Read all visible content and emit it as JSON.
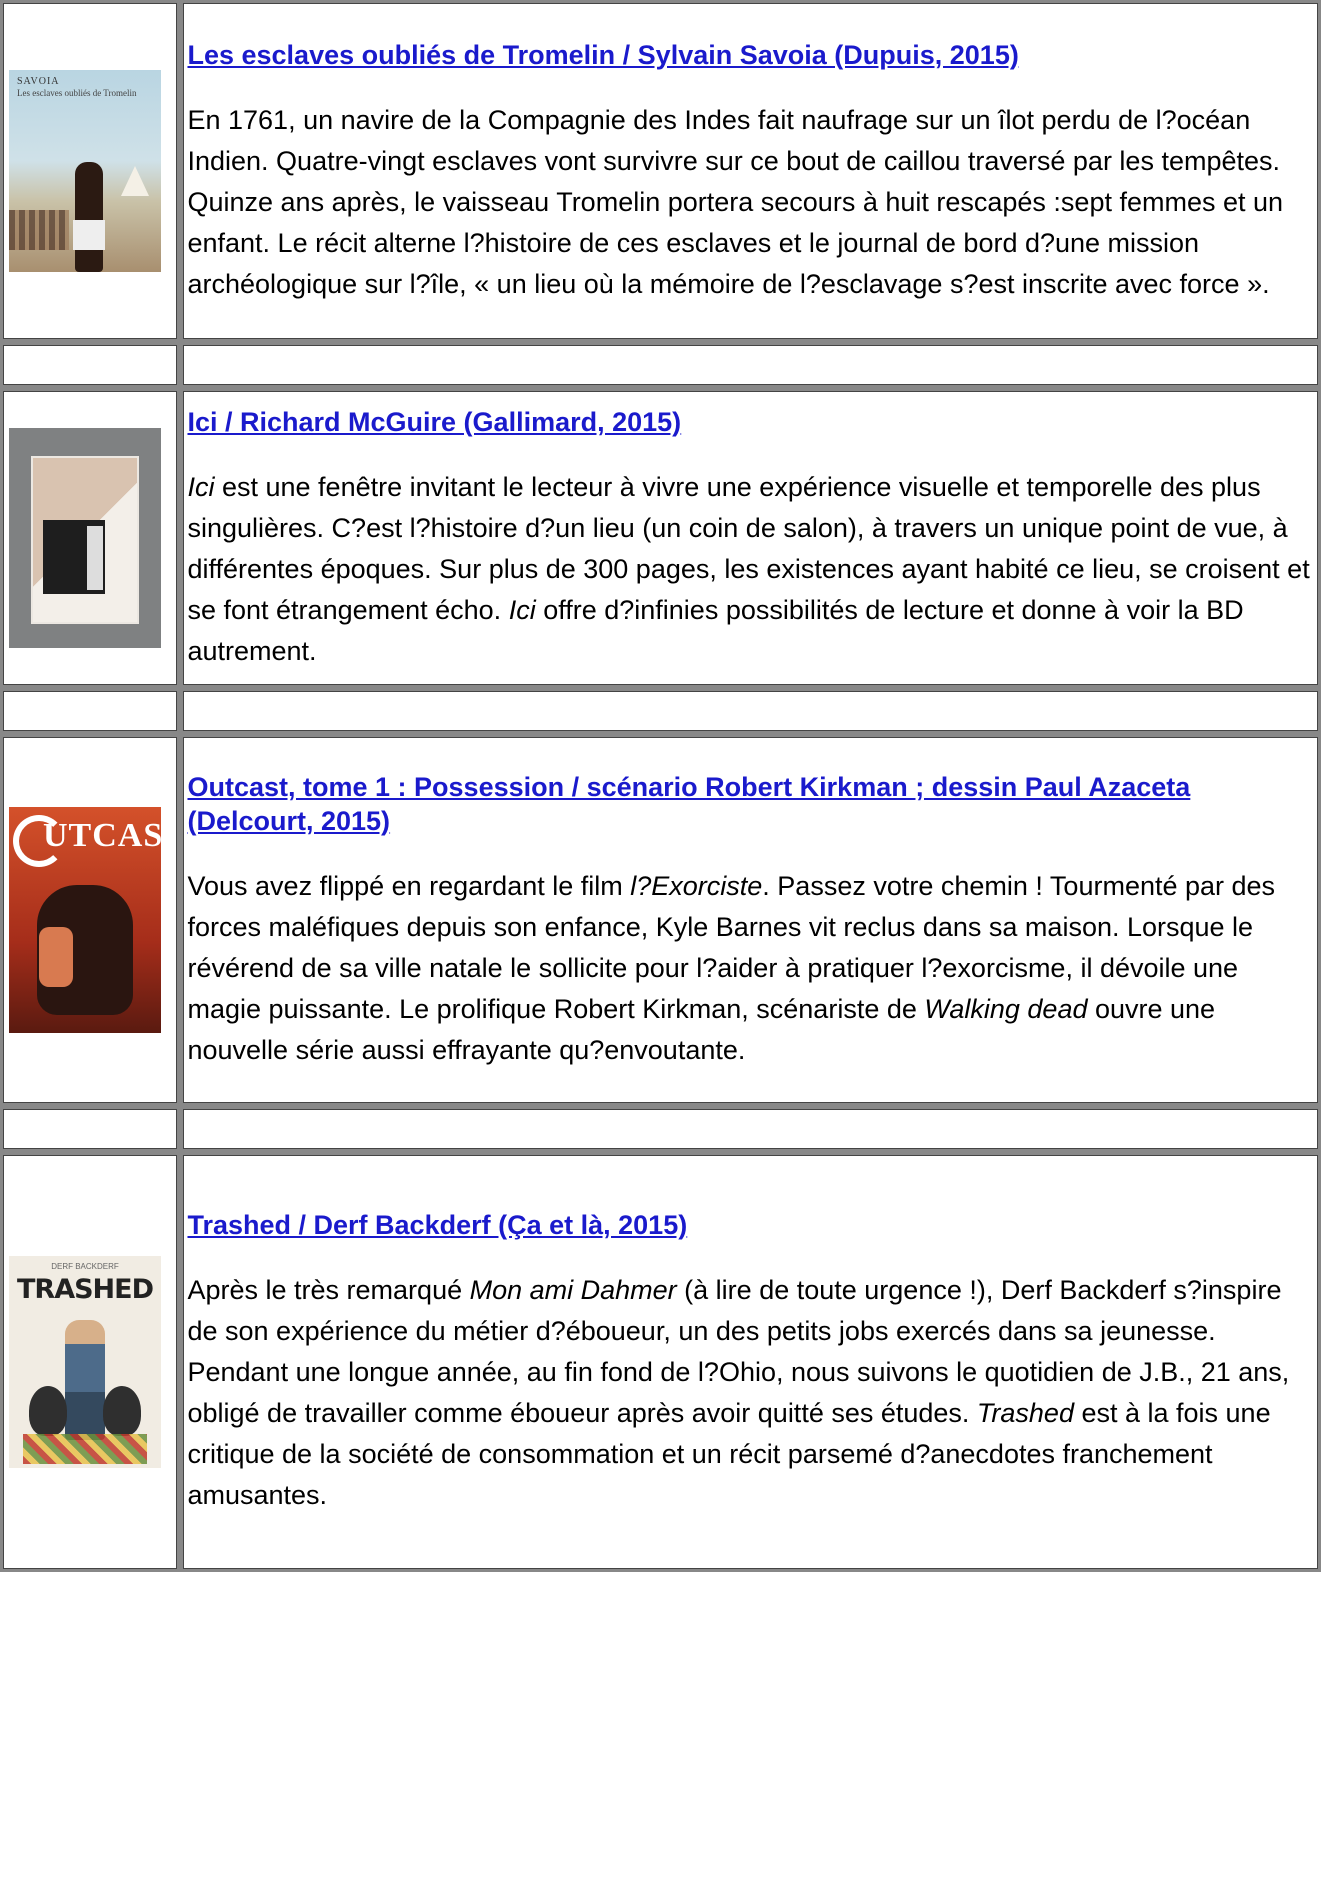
{
  "books": [
    {
      "cover_icon": "tromelin-cover",
      "cover_text": {
        "author": "SAVOIA",
        "title": "Les esclaves oubliés de Tromelin"
      },
      "title": "Les esclaves oubliés de Tromelin / Sylvain Savoia (Dupuis, 2015)",
      "description": "En 1761, un navire de la Compagnie des Indes fait naufrage sur un îlot perdu de l?océan Indien. Quatre-vingt esclaves vont survivre sur ce bout de caillou traversé par les tempêtes. Quinze ans après, le vaisseau Tromelin portera secours à huit rescapés :sept femmes et un enfant. Le récit alterne l?histoire de ces esclaves et le journal de bord d?une mission archéologique sur l?île, « un lieu où la mémoire de l?esclavage s?est inscrite avec force »."
    },
    {
      "cover_icon": "ici-cover",
      "title": "Ici / Richard McGuire (Gallimard, 2015)",
      "description_italic_lead": "Ici",
      "description_part1": " est une fenêtre invitant le lecteur à vivre une expérience visuelle et temporelle des plus singulières. C?est l?histoire d?un lieu (un coin de salon), à travers un unique point de vue, à différentes époques. Sur plus de 300 pages, les existences ayant habité ce lieu, se croisent et se font étrangement écho. ",
      "description_italic_2": "Ici",
      "description_part2": " offre d?infinies possibilités de lecture et donne à voir la BD autrement."
    },
    {
      "cover_icon": "outcast-cover",
      "cover_text": {
        "logo": "UTCAST"
      },
      "title": "Outcast, tome 1 : Possession / scénario Robert Kirkman ; dessin Paul Azaceta (Delcourt, 2015)",
      "description_part1": "Vous avez flippé en regardant le film ",
      "description_italic_1": "l?Exorciste",
      "description_part2": ". Passez votre chemin ! Tourmenté par des forces maléfiques depuis son enfance, Kyle Barnes vit reclus dans sa maison. Lorsque le révérend de sa ville natale le sollicite pour l?aider à pratiquer l?exorcisme, il dévoile une magie puissante. Le prolifique Robert Kirkman, scénariste de ",
      "description_italic_2": "Walking dead",
      "description_part3": " ouvre une nouvelle série aussi effrayante qu?envoutante."
    },
    {
      "cover_icon": "trashed-cover",
      "cover_text": {
        "author": "DERF BACKDERF",
        "title": "TRASHED"
      },
      "title": "Trashed / Derf Backderf (Ça et là, 2015)",
      "description_part1": "Après le très remarqué ",
      "description_italic_1": "Mon ami Dahmer",
      "description_part2": " (à lire de toute urgence !), Derf Backderf s?inspire de son expérience du métier d?éboueur, un des petits jobs exercés dans sa jeunesse. Pendant une longue année, au fin fond de l?Ohio, nous suivons le quotidien de J.B., 21 ans, obligé de travailler comme éboueur après avoir quitté ses études. ",
      "description_italic_2": "Trashed",
      "description_part3": " est à la fois une critique de la société de consommation et un récit parsemé d?anecdotes franchement amusantes."
    }
  ]
}
